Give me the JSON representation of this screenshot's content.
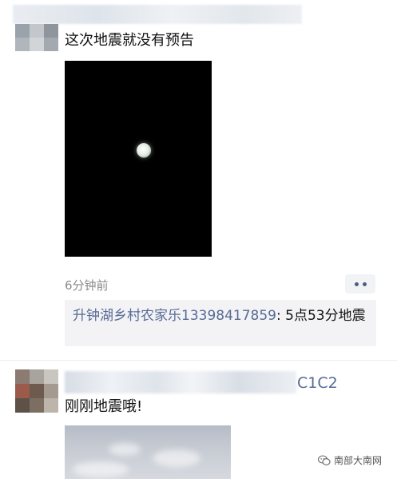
{
  "post1": {
    "text": "这次地震就没有预告",
    "timestamp": "6分钟前",
    "comment": {
      "author": "升钟湖乡村农家乐13398417859",
      "separator": ": ",
      "text": "5点53分地震"
    }
  },
  "post2": {
    "name_visible": "C1C2",
    "text": "刚刚地震哦!"
  },
  "watermark": {
    "text": "南部大南网"
  },
  "icons": {
    "more": "more-dots-icon",
    "watermark": "wechat-icon"
  },
  "colors": {
    "link": "#576b95",
    "comment_bg": "#f3f3f5",
    "timestamp": "#8a8a8a"
  }
}
